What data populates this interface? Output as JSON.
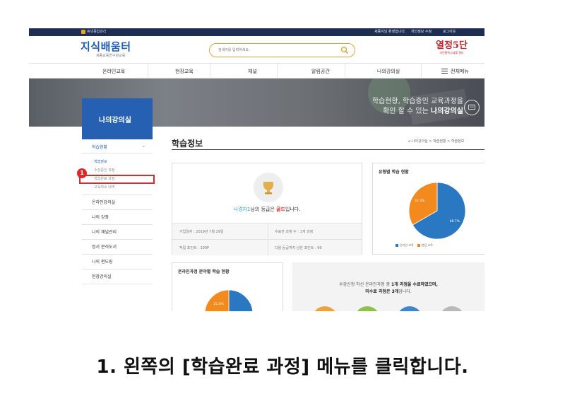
{
  "topbar": {
    "brand": "휴넷종합관리",
    "welcome": "세종지님 환영합니다.",
    "privacy": "개인정보 수정",
    "logout": "로그아웃"
  },
  "header": {
    "logo_title": "지식배움터",
    "logo_subtitle": "세종교육연구원교육",
    "search_placeholder": "검색어를 입력하세요.",
    "slogan_big": "열정5단",
    "slogan_small": "국민행복시대를 열다"
  },
  "gnb": {
    "items": [
      "온라인교육",
      "현장교육",
      "채널",
      "알림공간",
      "나의강의실"
    ],
    "all_menu": "전체메뉴"
  },
  "banner": {
    "line1": "학습현황, 학습증인 교육과정을",
    "line2_prefix": "확인 할 수 있는 ",
    "line2_bold": "나의강의실"
  },
  "sidebar": {
    "title": "나의강의실",
    "section_label": "학습현황",
    "sub_items": [
      "학습정보",
      "수강중인 과정",
      "학습완료 과정",
      "교육취소 내역"
    ],
    "links": [
      "온라인강의실",
      "나의 강좌",
      "나의 채널관리",
      "정서 분석도서",
      "나의 편도링",
      "현장강의실"
    ]
  },
  "annotation": {
    "step_number": "1",
    "caption": "1. 왼쪽의 [학습완료 과정] 메뉴를 클릭합니다."
  },
  "content": {
    "title": "학습정보",
    "breadcrumb": "나의강의실 > 학습현황 > 학습정보",
    "grade": {
      "name": "나경자1",
      "mid": "님의 등급은 ",
      "level": "골드",
      "end": "입니다."
    },
    "stats": {
      "join_date": "가입일자 : 2019년 7월 29일",
      "completed": "수료한 과정 수 : 1개 과정",
      "points": "적립 포인트 : 100P",
      "next_level": "다음 등급까지 남은 포인트 : 99"
    },
    "type_chart_title": "유형별 학습 현황",
    "field_chart_title": "온라인과정 분야별 학습 현황",
    "notice_line1_prefix": "수강신청 하신 온라인과정 중 ",
    "notice_line1_bold": "1개 과정을 수료하였으며,",
    "notice_line2_bold": "미수료 과정은 3개",
    "notice_line2_suffix": "입니다."
  },
  "chart_data": [
    {
      "type": "pie",
      "title": "유형별 학습 현황",
      "categories": [
        "온라인 교육",
        "현장 교육"
      ],
      "values": [
        66.7,
        33.3
      ],
      "labels": [
        "66.7%",
        "33.3%"
      ],
      "colors": [
        "#2b78c2",
        "#f28a1d"
      ],
      "legend": "bottom"
    },
    {
      "type": "pie",
      "title": "온라인과정 분야별 학습 현황",
      "categories": [
        "",
        ""
      ],
      "values": [
        75,
        25
      ],
      "labels": [
        "",
        "25.0%"
      ],
      "colors": [
        "#2b78c2",
        "#f28a1d"
      ]
    }
  ],
  "colors": {
    "brand_blue": "#2660b3",
    "accent_orange": "#e8a32c",
    "highlight_red": "#e0262b",
    "topbar_navy": "#1e2d52"
  }
}
